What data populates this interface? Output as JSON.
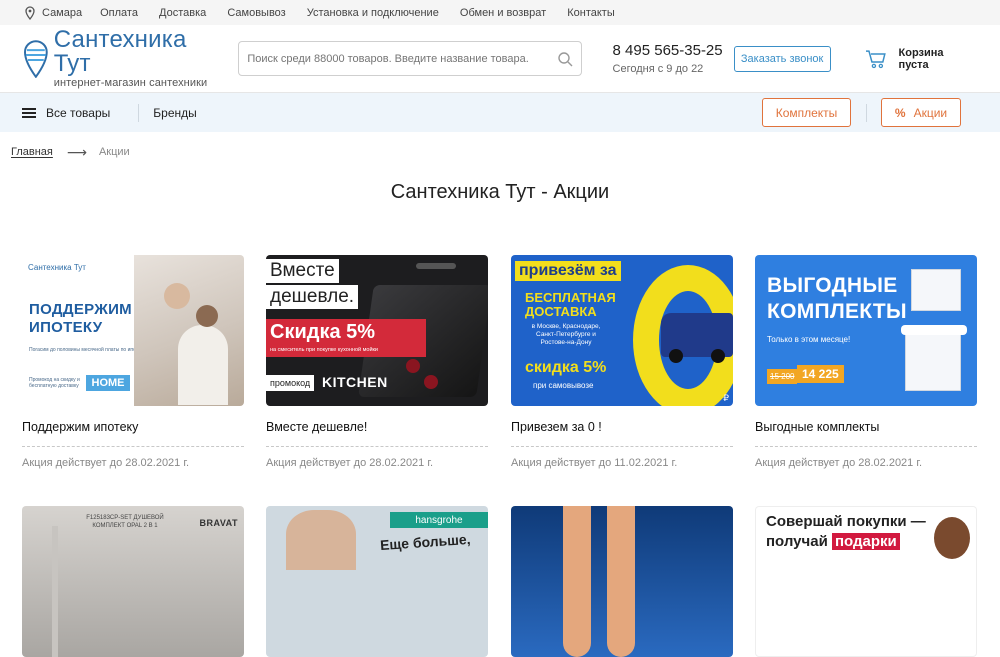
{
  "topbar": {
    "city": "Самара",
    "links": [
      "Оплата",
      "Доставка",
      "Самовывоз",
      "Установка и подключение",
      "Обмен и возврат",
      "Контакты"
    ]
  },
  "header": {
    "logo_title": "Сантехника Тут",
    "logo_subtitle": "интернет-магазин сантехники",
    "search_placeholder": "Поиск среди 88000 товаров. Введите название товара.",
    "phone": "8 495 565-35-25",
    "hours": "Сегодня с 9 до 22",
    "callback_label": "Заказать звонок",
    "cart_label": "Корзина пуста"
  },
  "navbar": {
    "all_goods": "Все товары",
    "brands": "Бренды",
    "kits": "Комплекты",
    "promo_icon": "%",
    "promo": "Акции"
  },
  "breadcrumb": {
    "home": "Главная",
    "current": "Акции"
  },
  "page_title": "Сантехника Тут - Акции",
  "promos": [
    {
      "title": "Поддержим ипотеку",
      "date": "Акция действует до 28.02.2021 г.",
      "banner": {
        "mini_logo": "Сантехника Тут",
        "headline_1": "ПОДДЕРЖИМ",
        "headline_2": "ИПОТЕКУ",
        "sub": "Погасим до половины месячной платы по ипотеке",
        "tiny": "Промокод на скидку и бесплатную доставку",
        "badge": "HOME"
      }
    },
    {
      "title": "Вместе дешевле!",
      "date": "Акция действует до 28.02.2021 г.",
      "banner": {
        "line_1": "Вместе",
        "line_2": "дешевле.",
        "discount": "Скидка 5%",
        "note": "на смеситель при покупке кухонной мойки",
        "promo_label": "промокод",
        "promo_code": "KITCHEN"
      }
    },
    {
      "title": "Привезем за 0 !",
      "date": "Акция действует до 11.02.2021 г.",
      "banner": {
        "headline": "привезём за",
        "free_1": "БЕСПЛАТНАЯ",
        "free_2": "ДОСТАВКА",
        "cities": "в Москве, Краснодаре, Санкт-Петербурге и Ростове-на-Дону",
        "discount": "скидка 5%",
        "pickup": "при самовывозе",
        "currency": "₽"
      }
    },
    {
      "title": "Выгодные комплекты",
      "date": "Акция действует до 28.02.2021 г.",
      "banner": {
        "headline_1": "ВЫГОДНЫЕ",
        "headline_2": "КОМПЛЕКТЫ",
        "sub": "Только в этом месяце!",
        "old_price": "15 200",
        "new_price": "14 225"
      }
    }
  ],
  "promos_row2": [
    {
      "box_text": "F125183CP-SET ДУШЕВОЙ КОМПЛЕКТ OPAL 2 В 1",
      "brand": "BRAVAT"
    },
    {
      "brand": "hansgrohe",
      "text": "Еще больше,"
    },
    {},
    {
      "line_1": "Совершай покупки —",
      "line_2_pre": "получай",
      "line_2_gift": "подарки"
    }
  ],
  "colors": {
    "brand_blue": "#2f6ea8",
    "accent_orange": "#e0733c",
    "callback_blue": "#3a8fc7",
    "navbar_bg": "#eef5fb"
  }
}
